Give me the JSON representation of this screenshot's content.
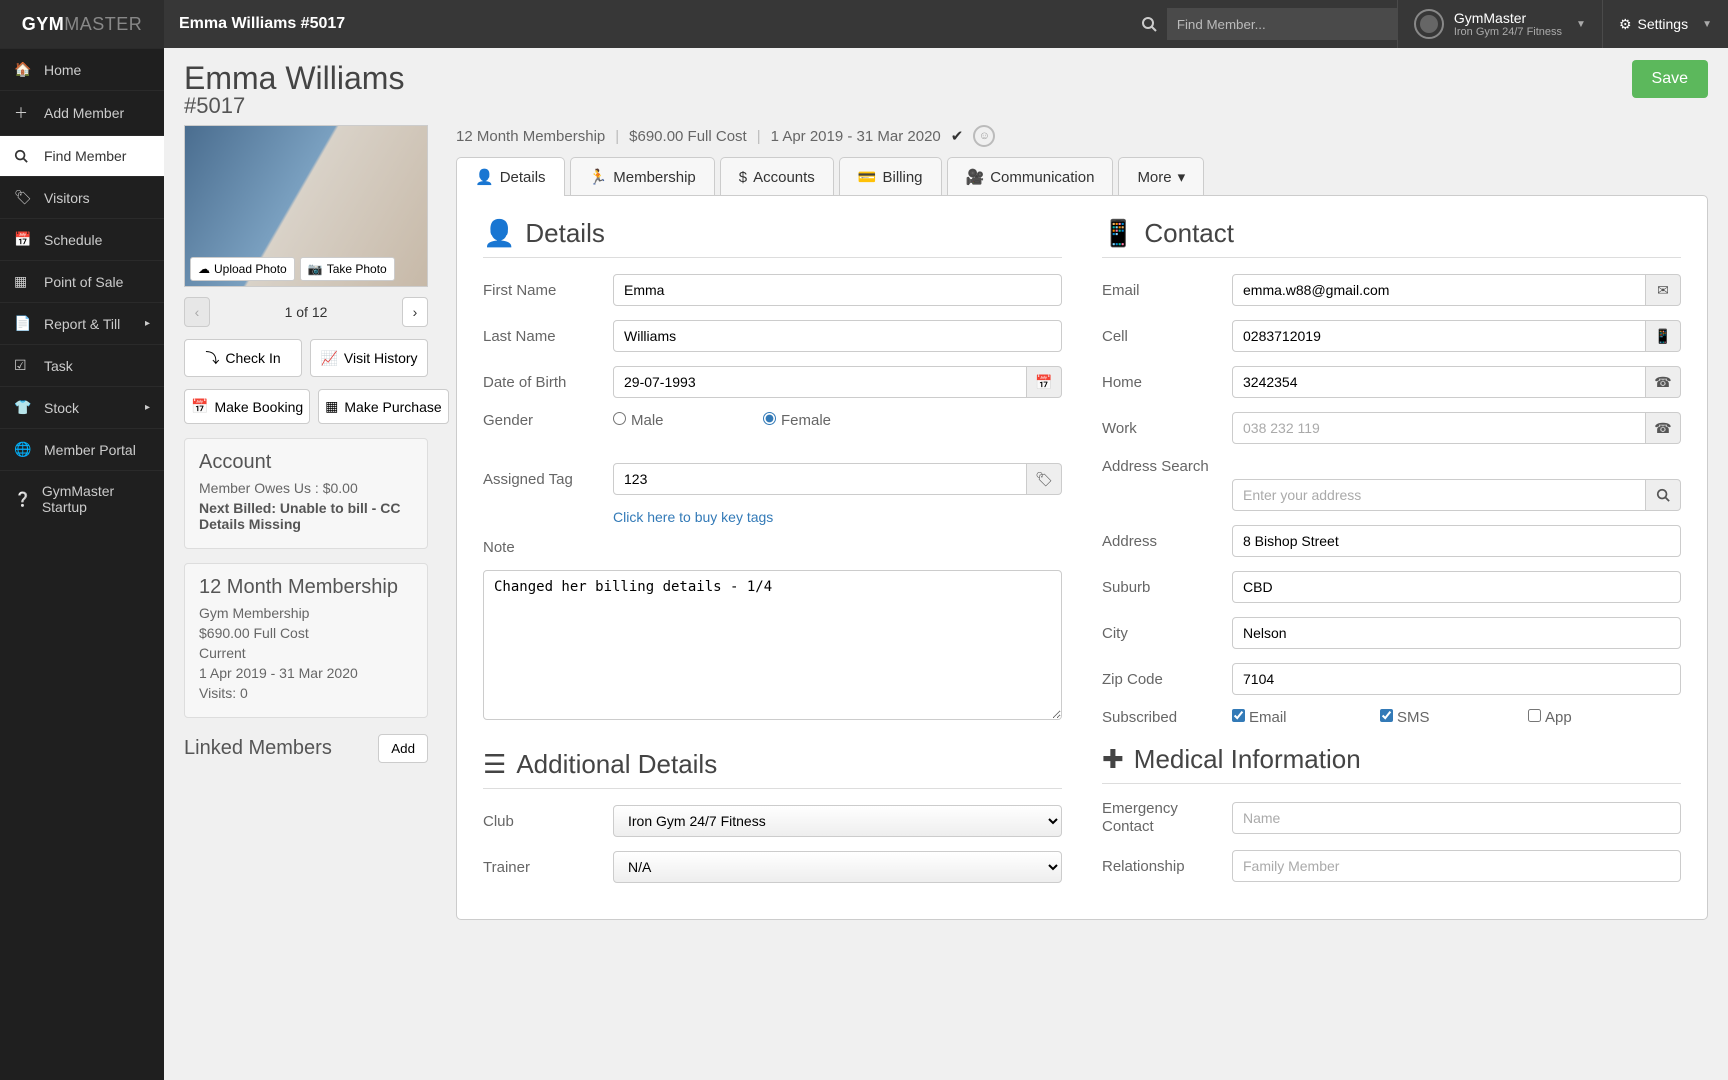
{
  "brand": {
    "strong": "GYM",
    "light": "MASTER"
  },
  "page_title": "Emma Williams #5017",
  "top": {
    "search_placeholder": "Find Member...",
    "user_name": "GymMaster",
    "user_sub": "Iron Gym 24/7 Fitness",
    "settings": "Settings"
  },
  "sidebar": {
    "items": [
      {
        "icon": "home",
        "label": "Home"
      },
      {
        "icon": "plus",
        "label": "Add Member"
      },
      {
        "icon": "search",
        "label": "Find Member",
        "active": true
      },
      {
        "icon": "tags",
        "label": "Visitors"
      },
      {
        "icon": "calendar",
        "label": "Schedule"
      },
      {
        "icon": "grid",
        "label": "Point of Sale"
      },
      {
        "icon": "file",
        "label": "Report & Till",
        "chev": true
      },
      {
        "icon": "check",
        "label": "Task"
      },
      {
        "icon": "shirt",
        "label": "Stock",
        "chev": true
      },
      {
        "icon": "globe",
        "label": "Member Portal"
      },
      {
        "icon": "help",
        "label": "GymMaster Startup"
      }
    ]
  },
  "member": {
    "name": "Emma Williams",
    "number": "#5017",
    "save": "Save",
    "summary": {
      "plan": "12 Month Membership",
      "cost": "$690.00 Full Cost",
      "dates": "1 Apr 2019 - 31 Mar 2020"
    },
    "photo": {
      "upload": "Upload Photo",
      "take": "Take Photo"
    },
    "pager": "1 of 12",
    "actions": {
      "checkin": "Check In",
      "visit_history": "Visit History",
      "make_booking": "Make Booking",
      "make_purchase": "Make Purchase"
    },
    "account_panel": {
      "title": "Account",
      "owes": "Member Owes Us : $0.00",
      "next": "Next Billed: Unable to bill - CC Details Missing"
    },
    "membership_panel": {
      "title": "12 Month Membership",
      "sub": "Gym Membership",
      "cost": "$690.00 Full Cost",
      "status": "Current",
      "range": "1 Apr 2019 - 31 Mar 2020",
      "visits": "Visits: 0"
    },
    "linked": {
      "title": "Linked Members",
      "add": "Add"
    }
  },
  "tabs": {
    "details": "Details",
    "membership": "Membership",
    "accounts": "Accounts",
    "billing": "Billing",
    "communication": "Communication",
    "more": "More"
  },
  "details": {
    "section": "Details",
    "first_name_label": "First Name",
    "first_name": "Emma",
    "last_name_label": "Last Name",
    "last_name": "Williams",
    "dob_label": "Date of Birth",
    "dob": "29-07-1993",
    "gender_label": "Gender",
    "male": "Male",
    "female": "Female",
    "tag_label": "Assigned Tag",
    "tag": "123",
    "buy_tags": "Click here to buy key tags",
    "note_label": "Note",
    "note": "Changed her billing details - 1/4",
    "additional_section": "Additional Details",
    "club_label": "Club",
    "club": "Iron Gym 24/7 Fitness",
    "trainer_label": "Trainer",
    "trainer": "N/A"
  },
  "contact": {
    "section": "Contact",
    "email_label": "Email",
    "email": "emma.w88@gmail.com",
    "cell_label": "Cell",
    "cell": "0283712019",
    "home_label": "Home",
    "home": "3242354",
    "work_label": "Work",
    "work_placeholder": "038 232 119",
    "address_search_label": "Address Search",
    "address_search_placeholder": "Enter your address",
    "address_label": "Address",
    "address": "8 Bishop Street",
    "suburb_label": "Suburb",
    "suburb": "CBD",
    "city_label": "City",
    "city": "Nelson",
    "zip_label": "Zip Code",
    "zip": "7104",
    "subscribed_label": "Subscribed",
    "sub_email": "Email",
    "sub_sms": "SMS",
    "sub_app": "App",
    "medical_section": "Medical Information",
    "emergency_label": "Emergency Contact",
    "emergency_placeholder": "Name",
    "relationship_label": "Relationship",
    "relationship_placeholder": "Family Member"
  }
}
